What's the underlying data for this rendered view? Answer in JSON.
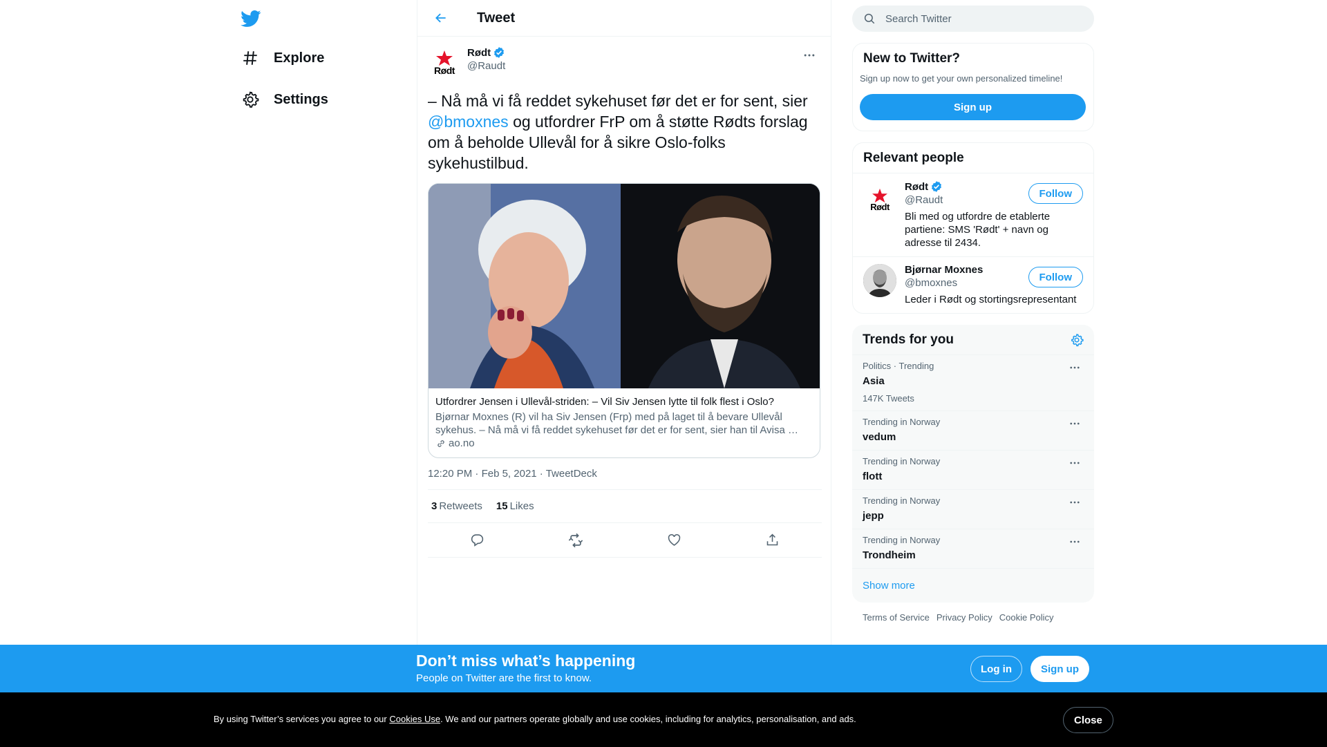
{
  "nav": {
    "items": [
      {
        "label": "Explore",
        "icon": "hashtag-icon"
      },
      {
        "label": "Settings",
        "icon": "gear-icon"
      }
    ]
  },
  "header": {
    "title": "Tweet"
  },
  "tweet": {
    "author_name": "Rødt",
    "author_handle": "@Raudt",
    "avatar_wordmark": "Rødt",
    "text_part1": "– Nå må vi få reddet sykehuset før det er for sent, sier ",
    "mention": "@bmoxnes",
    "text_part2": " og utfordrer FrP om å støtte Rødts forslag om å beholde Ullevål for å sikre Oslo-folks sykehustilbud.",
    "card": {
      "title": "Utfordrer Jensen i Ullevål-striden: – Vil Siv Jensen lytte til folk flest i Oslo?",
      "description": "Bjørnar Moxnes (R) vil ha Siv Jensen (Frp) med på laget til å bevare Ullevål sykehus. – Nå må vi få reddet sykehuset før det er for sent, sier han til Avisa …",
      "domain": "ao.no"
    },
    "time": "12:20 PM",
    "date": "Feb 5, 2021",
    "source": "TweetDeck",
    "retweets_count": "3",
    "retweets_label": "Retweets",
    "likes_count": "15",
    "likes_label": "Likes"
  },
  "search": {
    "placeholder": "Search Twitter"
  },
  "new_to_twitter": {
    "title": "New to Twitter?",
    "subtitle": "Sign up now to get your own personalized timeline!",
    "button": "Sign up"
  },
  "relevant": {
    "title": "Relevant people",
    "people": [
      {
        "name": "Rødt",
        "handle": "@Raudt",
        "bio": "Bli med og utfordre de etablerte partiene: SMS 'Rødt' + navn og adresse til 2434.",
        "follow": "Follow",
        "avatar_wordmark": "Rødt"
      },
      {
        "name": "Bjørnar Moxnes",
        "handle": "@bmoxnes",
        "bio": "Leder i Rødt og stortingsrepresentant",
        "follow": "Follow"
      }
    ]
  },
  "trends": {
    "title": "Trends for you",
    "items": [
      {
        "context": "Politics · Trending",
        "name": "Asia",
        "count": "147K Tweets"
      },
      {
        "context": "Trending in Norway",
        "name": "vedum"
      },
      {
        "context": "Trending in Norway",
        "name": "flott"
      },
      {
        "context": "Trending in Norway",
        "name": "jepp"
      },
      {
        "context": "Trending in Norway",
        "name": "Trondheim"
      }
    ],
    "show_more": "Show more"
  },
  "footer": {
    "links": [
      "Terms of Service",
      "Privacy Policy",
      "Cookie Policy"
    ]
  },
  "bottom_bar": {
    "title": "Don’t miss what’s happening",
    "subtitle": "People on Twitter are the first to know.",
    "login": "Log in",
    "signup": "Sign up"
  },
  "cookie": {
    "text_before": "By using Twitter’s services you agree to our ",
    "link": "Cookies Use",
    "text_after": ". We and our partners operate globally and use cookies, including for analytics, personalisation, and ads.",
    "close": "Close"
  },
  "colors": {
    "accent": "#1d9bf0",
    "text": "#0f1419",
    "secondary": "#536471",
    "verified": "#1d9bf0",
    "rodt_red": "#e5132b"
  }
}
